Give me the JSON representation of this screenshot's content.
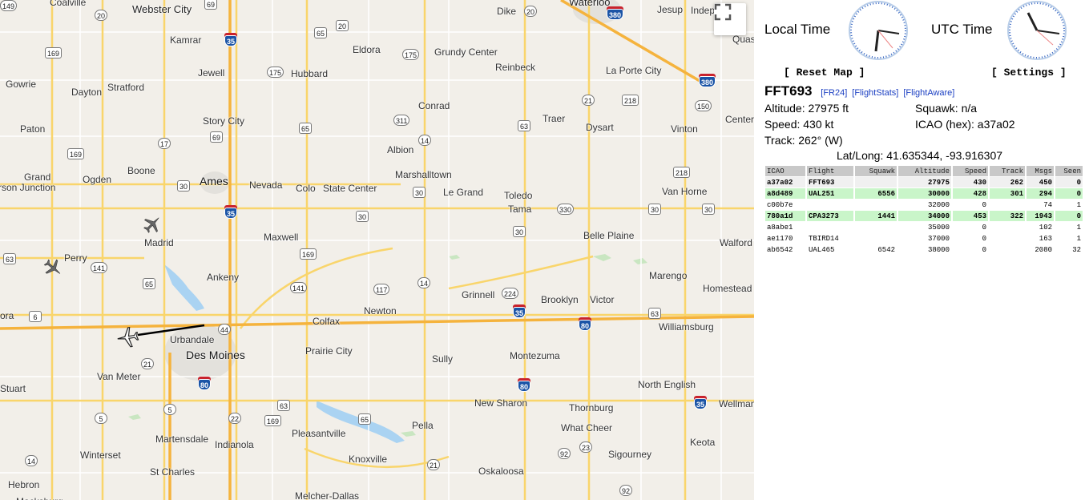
{
  "map": {
    "cities": [
      {
        "name": "Coalville",
        "cls": ""
      },
      {
        "name": "Webster City",
        "cls": "city"
      },
      {
        "name": "Kamrar",
        "cls": ""
      },
      {
        "name": "Jewell",
        "cls": ""
      },
      {
        "name": "Eldora",
        "cls": ""
      },
      {
        "name": "Hubbard",
        "cls": ""
      },
      {
        "name": "Grundy Center",
        "cls": ""
      },
      {
        "name": "Reinbeck",
        "cls": ""
      },
      {
        "name": "Dike",
        "cls": ""
      },
      {
        "name": "Waterloo",
        "cls": "city"
      },
      {
        "name": "Jesup",
        "cls": ""
      },
      {
        "name": "Indep",
        "cls": ""
      },
      {
        "name": "Quas",
        "cls": ""
      },
      {
        "name": "La Porte City",
        "cls": ""
      },
      {
        "name": "Gowrie",
        "cls": ""
      },
      {
        "name": "Dayton",
        "cls": ""
      },
      {
        "name": "Stratford",
        "cls": ""
      },
      {
        "name": "Conrad",
        "cls": ""
      },
      {
        "name": "Traer",
        "cls": ""
      },
      {
        "name": "Dysart",
        "cls": ""
      },
      {
        "name": "Vinton",
        "cls": ""
      },
      {
        "name": "Center",
        "cls": ""
      },
      {
        "name": "Paton",
        "cls": ""
      },
      {
        "name": "Story City",
        "cls": ""
      },
      {
        "name": "Albion",
        "cls": ""
      },
      {
        "name": "Boone",
        "cls": ""
      },
      {
        "name": "Grand",
        "cls": ""
      },
      {
        "name": "rson Junction",
        "cls": ""
      },
      {
        "name": "Ogden",
        "cls": ""
      },
      {
        "name": "Ames",
        "cls": "big"
      },
      {
        "name": "Nevada",
        "cls": ""
      },
      {
        "name": "Colo",
        "cls": ""
      },
      {
        "name": "State Center",
        "cls": ""
      },
      {
        "name": "Marshalltown",
        "cls": ""
      },
      {
        "name": "Le Grand",
        "cls": ""
      },
      {
        "name": "Toledo",
        "cls": ""
      },
      {
        "name": "Tama",
        "cls": ""
      },
      {
        "name": "Van Horne",
        "cls": ""
      },
      {
        "name": "Madrid",
        "cls": ""
      },
      {
        "name": "Maxwell",
        "cls": ""
      },
      {
        "name": "Belle Plaine",
        "cls": ""
      },
      {
        "name": "Walford",
        "cls": ""
      },
      {
        "name": "Perry",
        "cls": ""
      },
      {
        "name": "Marengo",
        "cls": ""
      },
      {
        "name": "Homestead",
        "cls": ""
      },
      {
        "name": "Ankeny",
        "cls": ""
      },
      {
        "name": "Grinnell",
        "cls": ""
      },
      {
        "name": "Brooklyn",
        "cls": ""
      },
      {
        "name": "Victor",
        "cls": ""
      },
      {
        "name": "Newton",
        "cls": ""
      },
      {
        "name": "ora",
        "cls": ""
      },
      {
        "name": "Colfax",
        "cls": ""
      },
      {
        "name": "Williamsburg",
        "cls": ""
      },
      {
        "name": "Urbandale",
        "cls": ""
      },
      {
        "name": "Des Moines",
        "cls": "big"
      },
      {
        "name": "Prairie City",
        "cls": ""
      },
      {
        "name": "Sully",
        "cls": ""
      },
      {
        "name": "Montezuma",
        "cls": ""
      },
      {
        "name": "Van Meter",
        "cls": ""
      },
      {
        "name": "North English",
        "cls": ""
      },
      {
        "name": "Stuart",
        "cls": ""
      },
      {
        "name": "New Sharon",
        "cls": ""
      },
      {
        "name": "Thornburg",
        "cls": ""
      },
      {
        "name": "Wellman",
        "cls": ""
      },
      {
        "name": "Pella",
        "cls": ""
      },
      {
        "name": "What Cheer",
        "cls": ""
      },
      {
        "name": "Martensdale",
        "cls": ""
      },
      {
        "name": "Indianola",
        "cls": ""
      },
      {
        "name": "Pleasantville",
        "cls": ""
      },
      {
        "name": "Keota",
        "cls": ""
      },
      {
        "name": "Winterset",
        "cls": ""
      },
      {
        "name": "Sigourney",
        "cls": ""
      },
      {
        "name": "St Charles",
        "cls": ""
      },
      {
        "name": "Knoxville",
        "cls": ""
      },
      {
        "name": "Oskaloosa",
        "cls": ""
      },
      {
        "name": "Hebron",
        "cls": ""
      },
      {
        "name": "Melcher-Dallas",
        "cls": ""
      },
      {
        "name": "Macksburg",
        "cls": ""
      }
    ],
    "shields": [
      {
        "n": "69",
        "t": "us"
      },
      {
        "n": "20",
        "t": "st"
      },
      {
        "n": "35",
        "t": "i"
      },
      {
        "n": "65",
        "t": "us"
      },
      {
        "n": "20",
        "t": "us"
      },
      {
        "n": "20",
        "t": "st"
      },
      {
        "n": "380",
        "t": "i"
      },
      {
        "n": "169",
        "t": "us"
      },
      {
        "n": "175",
        "t": "st"
      },
      {
        "n": "175",
        "t": "st"
      },
      {
        "n": "380",
        "t": "i"
      },
      {
        "n": "218",
        "t": "us"
      },
      {
        "n": "21",
        "t": "st"
      },
      {
        "n": "150",
        "t": "st"
      },
      {
        "n": "311",
        "t": "st"
      },
      {
        "n": "65",
        "t": "us"
      },
      {
        "n": "63",
        "t": "us"
      },
      {
        "n": "69",
        "t": "us"
      },
      {
        "n": "17",
        "t": "st"
      },
      {
        "n": "14",
        "t": "st"
      },
      {
        "n": "169",
        "t": "us"
      },
      {
        "n": "218",
        "t": "us"
      },
      {
        "n": "30",
        "t": "us"
      },
      {
        "n": "30",
        "t": "us"
      },
      {
        "n": "35",
        "t": "i"
      },
      {
        "n": "30",
        "t": "us"
      },
      {
        "n": "330",
        "t": "st"
      },
      {
        "n": "30",
        "t": "us"
      },
      {
        "n": "30",
        "t": "us"
      },
      {
        "n": "30",
        "t": "us"
      },
      {
        "n": "63",
        "t": "us"
      },
      {
        "n": "141",
        "t": "st"
      },
      {
        "n": "169",
        "t": "us"
      },
      {
        "n": "65",
        "t": "us"
      },
      {
        "n": "141",
        "t": "st"
      },
      {
        "n": "117",
        "t": "st"
      },
      {
        "n": "14",
        "t": "st"
      },
      {
        "n": "224",
        "t": "st"
      },
      {
        "n": "6",
        "t": "us"
      },
      {
        "n": "44",
        "t": "st"
      },
      {
        "n": "35",
        "t": "i"
      },
      {
        "n": "80",
        "t": "i"
      },
      {
        "n": "63",
        "t": "us"
      },
      {
        "n": "21",
        "t": "st"
      },
      {
        "n": "80",
        "t": "i"
      },
      {
        "n": "80",
        "t": "i"
      },
      {
        "n": "5",
        "t": "st"
      },
      {
        "n": "63",
        "t": "us"
      },
      {
        "n": "35",
        "t": "i"
      },
      {
        "n": "5",
        "t": "st"
      },
      {
        "n": "22",
        "t": "st"
      },
      {
        "n": "169",
        "t": "us"
      },
      {
        "n": "65",
        "t": "us"
      },
      {
        "n": "23",
        "t": "st"
      },
      {
        "n": "14",
        "t": "st"
      },
      {
        "n": "21",
        "t": "st"
      },
      {
        "n": "92",
        "t": "st"
      },
      {
        "n": "92",
        "t": "st"
      },
      {
        "n": "92",
        "t": "st"
      },
      {
        "n": "149",
        "t": "st"
      }
    ]
  },
  "fullscreen_icon": "fullscreen-icon",
  "clocks": {
    "local_label": "Local Time",
    "utc_label": "UTC Time"
  },
  "buttons": {
    "reset_map": "[ Reset Map ]",
    "settings": "[ Settings ]"
  },
  "selected": {
    "flight": "FFT693",
    "links": [
      "[FR24]",
      "[FlightStats]",
      "[FlightAware]"
    ],
    "altitude": "Altitude: 27975 ft",
    "squawk": "Squawk: n/a",
    "speed": "Speed: 430 kt",
    "icao": "ICAO (hex): a37a02",
    "track": "Track: 262° (W)",
    "latlong": "Lat/Long: 41.635344, -93.916307"
  },
  "table": {
    "headers": [
      "ICAO",
      "Flight",
      "Squawk",
      "Altitude",
      "Speed",
      "Track",
      "Msgs",
      "Seen"
    ],
    "rows": [
      {
        "icao": "a37a02",
        "flight": "FFT693",
        "squawk": "",
        "altitude": "27975",
        "speed": "430",
        "track": "262",
        "msgs": "450",
        "seen": "0",
        "style": "selected"
      },
      {
        "icao": "a8d489",
        "flight": "UAL251",
        "squawk": "6556",
        "altitude": "30000",
        "speed": "428",
        "track": "301",
        "msgs": "294",
        "seen": "0",
        "style": "squawk"
      },
      {
        "icao": "c00b7e",
        "flight": "",
        "squawk": "",
        "altitude": "32000",
        "speed": "0",
        "track": "",
        "msgs": "74",
        "seen": "1",
        "style": ""
      },
      {
        "icao": "780a1d",
        "flight": "CPA3273",
        "squawk": "1441",
        "altitude": "34000",
        "speed": "453",
        "track": "322",
        "msgs": "1943",
        "seen": "0",
        "style": "squawk"
      },
      {
        "icao": "a8abe1",
        "flight": "",
        "squawk": "",
        "altitude": "35000",
        "speed": "0",
        "track": "",
        "msgs": "102",
        "seen": "1",
        "style": ""
      },
      {
        "icao": "ae1170",
        "flight": "TBIRD14",
        "squawk": "",
        "altitude": "37000",
        "speed": "0",
        "track": "",
        "msgs": "163",
        "seen": "1",
        "style": ""
      },
      {
        "icao": "ab6542",
        "flight": "UAL465",
        "squawk": "6542",
        "altitude": "38000",
        "speed": "0",
        "track": "",
        "msgs": "2080",
        "seen": "32",
        "style": ""
      }
    ]
  }
}
